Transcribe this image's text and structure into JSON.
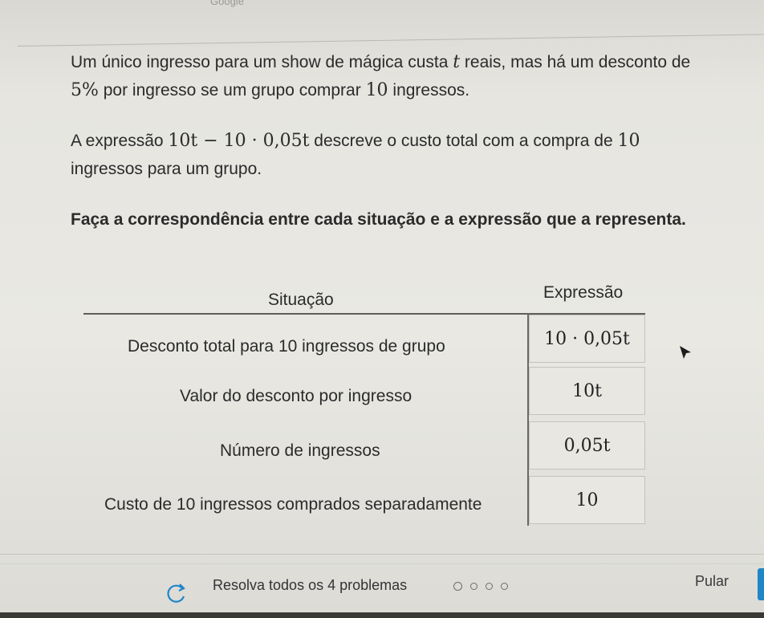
{
  "header": {
    "partial_label": "Google"
  },
  "question": {
    "p1": {
      "text_a": "Um único ingresso para um show de mágica custa ",
      "var_t": "t",
      "text_b": " reais, mas há um desconto de ",
      "percent": "5%",
      "text_c": " por ingresso se um grupo comprar ",
      "count": "10",
      "text_d": " ingressos."
    },
    "p2": {
      "text_a": "A expressão ",
      "expr": "10t − 10 · 0,05t",
      "text_b": " descreve o custo total com a compra de ",
      "count": "10",
      "text_c": " ingressos para um grupo."
    },
    "p3": "Faça a correspondência entre cada situação e a expressão que a representa."
  },
  "table": {
    "headers": {
      "situation": "Situação",
      "expression": "Expressão"
    },
    "situations": [
      "Desconto total para 10 ingressos de grupo",
      "Valor do desconto por ingresso",
      "Número de ingressos",
      "Custo de 10 ingressos comprados separadamente"
    ],
    "expressions": [
      "10 · 0,05t",
      "10t",
      "0,05t",
      "10"
    ]
  },
  "footer": {
    "progress_text": "Resolva todos os 4 problemas",
    "skip_label": "Pular",
    "retry_icon": "retry-icon",
    "progress_dots": 4
  },
  "colors": {
    "accent": "#1f86c7",
    "background": "#e7e6e1",
    "text": "#2b2b2b"
  }
}
